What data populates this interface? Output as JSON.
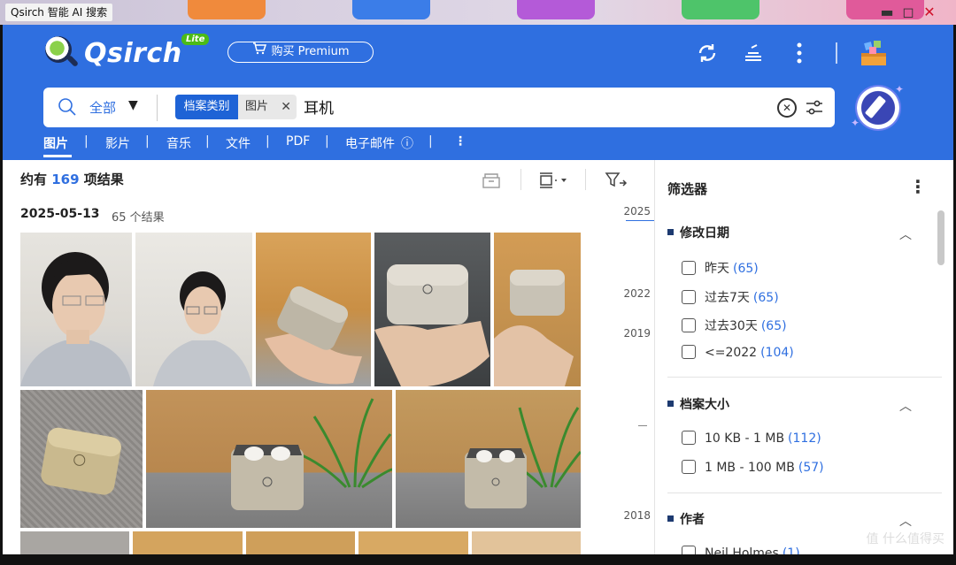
{
  "window": {
    "title": "Qsirch 智能 AI 搜索",
    "minimize": "▬",
    "maximize": "◻",
    "close": "✕"
  },
  "header": {
    "logo_text": "Qsirch",
    "logo_badge": "Lite",
    "premium_label": "购买 Premium",
    "icons": [
      "sync-icon",
      "layers-icon",
      "more-vertical-icon",
      "apps-box-icon",
      "ai-assistant-icon"
    ]
  },
  "search": {
    "scope": "全部",
    "chip_key": "档案类别",
    "chip_value": "图片",
    "query": "耳机"
  },
  "categories": [
    "图片",
    "影片",
    "音乐",
    "文件",
    "PDF",
    "电子邮件"
  ],
  "results": {
    "prefix": "约有",
    "count": "169",
    "suffix": "项结果",
    "group_date": "2025-05-13",
    "group_count": "65 个结果"
  },
  "timeline": [
    "2025",
    "2022",
    "2019",
    "2018"
  ],
  "filters": {
    "title": "筛选器",
    "sections": [
      {
        "title": "修改日期",
        "options": [
          {
            "label": "昨天",
            "count": "(65)"
          },
          {
            "label": "过去7天",
            "count": "(65)"
          },
          {
            "label": "过去30天",
            "count": "(65)"
          },
          {
            "label": "<=2022",
            "count": "(104)"
          }
        ]
      },
      {
        "title": "档案大小",
        "options": [
          {
            "label": "10 KB - 1 MB",
            "count": "(112)"
          },
          {
            "label": "1 MB - 100 MB",
            "count": "(57)"
          }
        ]
      },
      {
        "title": "作者",
        "options": [
          {
            "label": "Neil Holmes",
            "count": "(1)"
          }
        ]
      }
    ]
  },
  "watermark": "值 什么值得买",
  "colors": {
    "header_blue": "#2f6fe0",
    "chip_blue": "#1e63d6",
    "count_blue": "#2f6fe0"
  }
}
